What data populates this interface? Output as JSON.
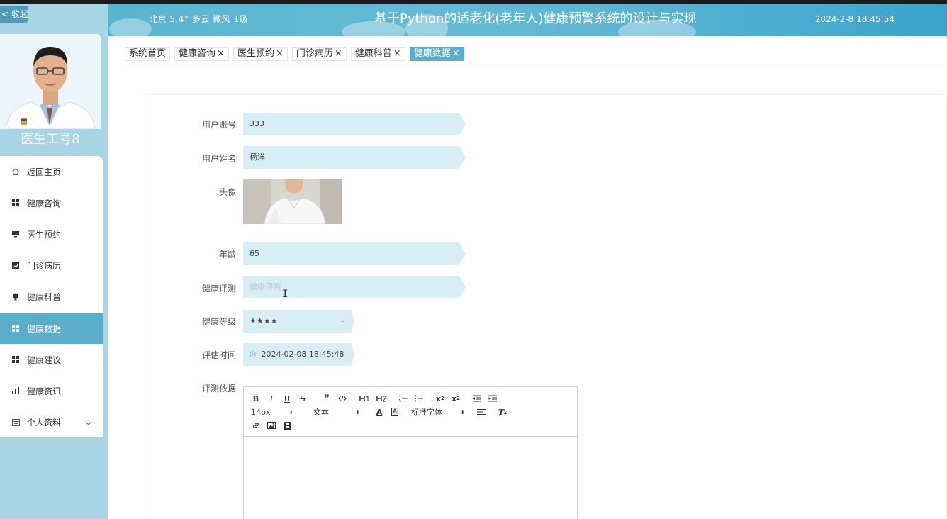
{
  "sidebar": {
    "collapse_label": "< 收起",
    "doctor_name": "医生工号8",
    "menu": [
      {
        "label": "返回主页",
        "icon": "home-icon"
      },
      {
        "label": "健康咨询",
        "icon": "grid-icon"
      },
      {
        "label": "医生预约",
        "icon": "monitor-icon"
      },
      {
        "label": "门诊病历",
        "icon": "chart-icon"
      },
      {
        "label": "健康科普",
        "icon": "bulb-icon"
      },
      {
        "label": "健康数据",
        "icon": "grid-icon",
        "active": true
      },
      {
        "label": "健康建议",
        "icon": "grid-icon"
      },
      {
        "label": "健康资讯",
        "icon": "bar-chart-icon"
      },
      {
        "label": "个人资料",
        "icon": "profile-icon",
        "has_submenu": true
      }
    ]
  },
  "header": {
    "weather": "北京 5.4° 多云 微风 1级",
    "title": "基于Python的适老化(老年人)健康预警系统的设计与实现",
    "datetime": "2024-2-8 18:45:54"
  },
  "tabs": [
    {
      "label": "系统首页",
      "closable": false
    },
    {
      "label": "健康咨询",
      "closable": true
    },
    {
      "label": "医生预约",
      "closable": true
    },
    {
      "label": "门诊病历",
      "closable": true
    },
    {
      "label": "健康科普",
      "closable": true
    },
    {
      "label": "健康数据",
      "closable": true,
      "active": true
    }
  ],
  "tab_close_glyph": "×",
  "form": {
    "account": {
      "label": "用户账号",
      "value": "333"
    },
    "name": {
      "label": "用户姓名",
      "value": "杨洋"
    },
    "avatar": {
      "label": "头像"
    },
    "age": {
      "label": "年龄",
      "value": "65"
    },
    "assessment": {
      "label": "健康评测",
      "placeholder": "健康评测"
    },
    "level": {
      "label": "健康等级",
      "value": "★★★★"
    },
    "eval_time": {
      "label": "评估时间",
      "value": "2024-02-08 18:45:48"
    },
    "basis": {
      "label": "评测依据"
    }
  },
  "editor": {
    "font_size": "14px",
    "block_type": "文本",
    "font_family": "标准字体"
  },
  "colors": {
    "accent": "#5aaec9",
    "sidebar_bg": "#a8d5e4",
    "field_bg": "#d9edf4"
  }
}
